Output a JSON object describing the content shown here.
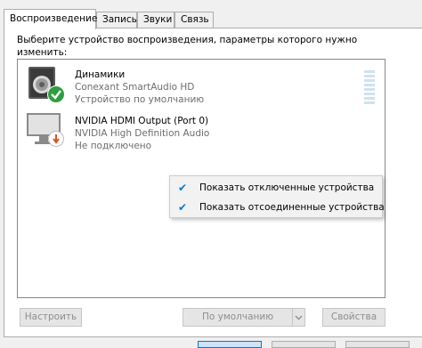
{
  "tabs": [
    {
      "label": "Воспроизведение"
    },
    {
      "label": "Запись"
    },
    {
      "label": "Звуки"
    },
    {
      "label": "Связь"
    }
  ],
  "intro_text": "Выберите устройство воспроизведения, параметры которого нужно изменить:",
  "devices": [
    {
      "name": "Динамики",
      "driver": "Conexant SmartAudio HD",
      "status": "Устройство по умолчанию",
      "icon": "speaker-icon",
      "badge": "default-check-badge",
      "badge_color": "#2e9e3e"
    },
    {
      "name": "NVIDIA HDMI Output (Port 0)",
      "driver": "NVIDIA High Definition Audio",
      "status": "Не подключено",
      "icon": "monitor-icon",
      "badge": "disconnected-badge",
      "badge_color": "#d9541e"
    }
  ],
  "context_menu": [
    {
      "label": "Показать отключенные устройства",
      "checked": true
    },
    {
      "label": "Показать отсоединенные устройства",
      "checked": true
    }
  ],
  "buttons": {
    "configure": "Настроить",
    "set_default": "По умолчанию",
    "properties": "Свойства"
  },
  "accent_color": "#0078d7"
}
